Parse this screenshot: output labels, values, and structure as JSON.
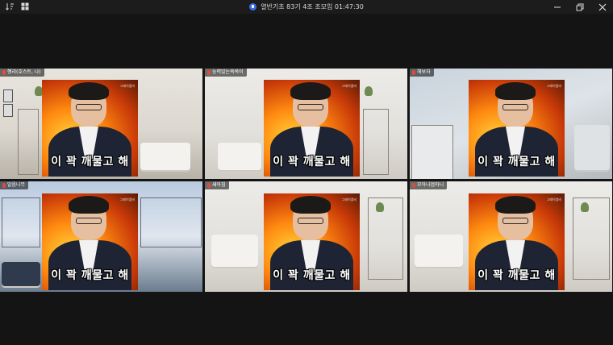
{
  "window": {
    "title": "열반기초 83기 4조 조모임 01:47:30",
    "left_icons": [
      "sort-icon",
      "grid-view-icon"
    ],
    "right_buttons": [
      "minimize-icon",
      "restore-icon",
      "close-icon"
    ]
  },
  "participants": [
    {
      "name": "행리(호스트, 나)",
      "caption": "이 꽉 깨물고 해",
      "video_logo": "그래이엠비"
    },
    {
      "name": "능력있는쏙쏙이",
      "caption": "이 꽉 깨물고 해",
      "video_logo": "그래이엠비"
    },
    {
      "name": "해보자",
      "caption": "이 꽉 깨물고 해",
      "video_logo": "그래이엠비"
    },
    {
      "name": "말음나무",
      "caption": "이 꽉 깨물고 해",
      "video_logo": "그래이엠비"
    },
    {
      "name": "새아침",
      "caption": "이 꽉 깨물고 해",
      "video_logo": "그래이엠비"
    },
    {
      "name": "모아나엄마니",
      "caption": "이 꽉 깨물고 해",
      "video_logo": "그래이엠비"
    }
  ],
  "colors": {
    "background": "#141414",
    "titlebar": "#1c1c1c",
    "secure_icon": "#3a6ee8",
    "mic_muted": "#e14b3c"
  }
}
